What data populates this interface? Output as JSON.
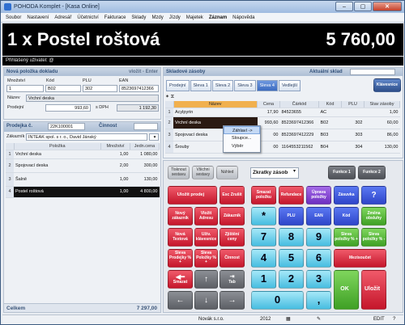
{
  "window": {
    "title": "POHODA Komplet - [Kasa Online]"
  },
  "menu": [
    "Soubor",
    "Nastavení",
    "Adresář",
    "Účetnictví",
    "Fakturace",
    "Sklady",
    "Mzdy",
    "Jízdy",
    "Majetek",
    "Záznam",
    "Nápověda"
  ],
  "display": {
    "item": "1 x  Postel roštová",
    "price": "5 760,00"
  },
  "user_label": "Přihlášený uživatel: @",
  "new_item": {
    "title": "Nová položka dokladu",
    "hint": "vložit - Enter",
    "labels": {
      "qty": "Množství",
      "code": "Kód",
      "plu": "PLU",
      "ean": "EAN",
      "name": "Název",
      "price": "Prodejní",
      "vat": "s DPH"
    },
    "qty": "1",
    "code": "B02",
    "plu": "302",
    "ean": "8523697412366",
    "name": "Vrchní deska",
    "price": "993,60",
    "price_vat": "1 192,30"
  },
  "sale": {
    "title": "Prodejka č.",
    "number": "22K100001",
    "activity": "Činnost",
    "customer_label": "Zákazník",
    "customer": "INTEAK spol. s r. o., David Jánský",
    "columns": [
      "Položka",
      "Množství",
      "Jedn.cena"
    ],
    "rows": [
      {
        "n": "1",
        "item": "Vrchní deska",
        "qty": "1,00",
        "price": "1 080,00"
      },
      {
        "n": "2",
        "item": "Spojovací deska",
        "qty": "2,00",
        "price": "300,00"
      },
      {
        "n": "3",
        "item": "Šalně",
        "qty": "1,00",
        "price": "130,00"
      },
      {
        "n": "4",
        "item": "Postel roštová",
        "qty": "1,00",
        "price": "4 800,00"
      }
    ],
    "total_label": "Celkem",
    "total": "7 297,00"
  },
  "stock": {
    "title": "Skladové zásoby",
    "warehouse_label": "Aktuální sklad",
    "tabs": [
      "Prodejní",
      "Sleva 1",
      "Sleva 2",
      "Sleva 3",
      "Sleva 4",
      "Vedlejší"
    ],
    "active_tab": 4,
    "clipboard_button": "Klávesnice",
    "columns": [
      "Název",
      "Cena",
      "Čárkód",
      "Kód",
      "PLU",
      "Stav zásoby"
    ],
    "rows": [
      {
        "n": "1",
        "name": "Acylpyrin",
        "price": "17,90",
        "barcode": "84523655",
        "code": "AC",
        "plu": "",
        "stock": "1,00"
      },
      {
        "n": "2",
        "name": "Vrchní deska",
        "price": "993,60",
        "barcode": "8523697412366",
        "code": "B02",
        "plu": "302",
        "stock": "60,00"
      },
      {
        "n": "3",
        "name": "Spojovací deska",
        "price": "00",
        "barcode": "8523697412229",
        "code": "B03",
        "plu": "303",
        "stock": "86,00"
      },
      {
        "n": "4",
        "name": "Šrouby",
        "price": "00",
        "barcode": "1164553211562",
        "code": "B04",
        "plu": "304",
        "stock": "130,00"
      }
    ],
    "context_menu": [
      "Záhlaví ->",
      "Sloupce...",
      "Výběr"
    ]
  },
  "keypad": {
    "top": [
      "Tisknout sestavu",
      "Všichni sestavy",
      "Náhled"
    ],
    "shortcuts_select": "Zkratky zásob",
    "func": [
      "Funkce 1",
      "Funkce 2"
    ],
    "left": [
      "Uložit prodej",
      "Esc Zrušit",
      "Nový zákazník",
      "Vložit Adresu",
      "Zákazník",
      "Nová Textová",
      "Užív. klávesnice",
      "Zjištění ceny",
      "Sleva Prodejky % +",
      "Sleva Položky % +",
      "Činnost",
      "Smazat",
      "Tab"
    ],
    "right_top": [
      "Smazat položku",
      "Refundace",
      "Úprava položky",
      "Zásuvka",
      "?"
    ],
    "right_mid": [
      "*",
      "PLU",
      "EAN",
      "Kód",
      "Změna obsluhy"
    ],
    "digits": [
      "7",
      "8",
      "9",
      "4",
      "5",
      "6",
      "1",
      "2",
      "3",
      "0",
      ","
    ],
    "right_side": [
      "Sleva položky % +",
      "Sleva položky % -",
      "Mezisoučet",
      "OK",
      "Uložit"
    ]
  },
  "status": {
    "company": "Novák s.r.o.",
    "year": "2012",
    "mode": "EDIT"
  }
}
